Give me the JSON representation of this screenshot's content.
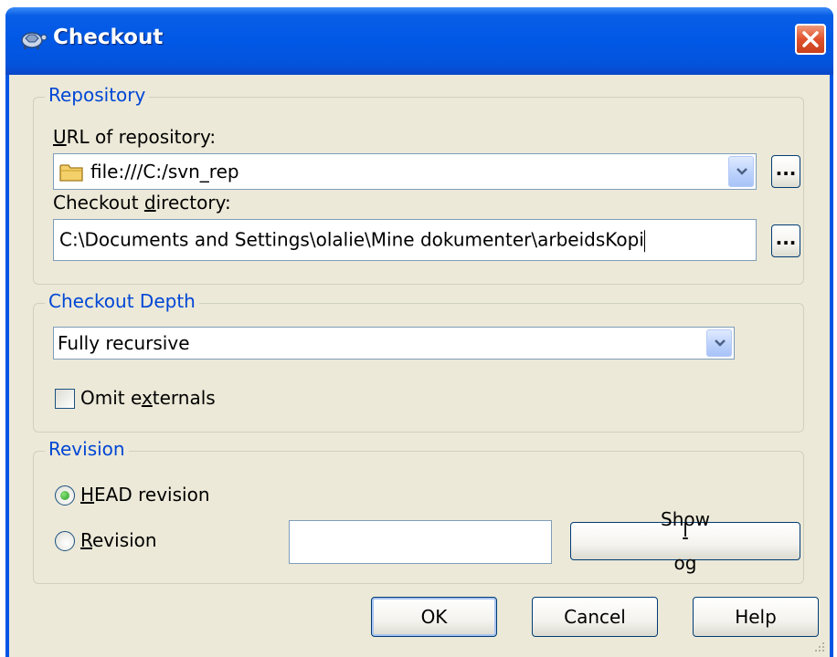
{
  "window": {
    "title": "Checkout"
  },
  "repository": {
    "legend": "Repository",
    "url_label": "URL of repository:",
    "url_value": "file:///C:/svn_rep",
    "dir_label": "Checkout directory:",
    "dir_value": "C:\\Documents and Settings\\olalie\\Mine dokumenter\\arbeidsKopi",
    "browse_label": "..."
  },
  "depth": {
    "legend": "Checkout Depth",
    "selected": "Fully recursive",
    "omit_externals_label": "Omit externals",
    "omit_externals_checked": false
  },
  "revision": {
    "legend": "Revision",
    "head_label": "HEAD revision",
    "head_selected": true,
    "revision_label": "Revision",
    "revision_value": "",
    "show_log_label": "Show log"
  },
  "buttons": {
    "ok": "OK",
    "cancel": "Cancel",
    "help": "Help"
  },
  "colors": {
    "title_bar": "#0058e6",
    "dialog_bg": "#ece9d8",
    "legend_text": "#0046d5",
    "close_red": "#e0522c"
  }
}
